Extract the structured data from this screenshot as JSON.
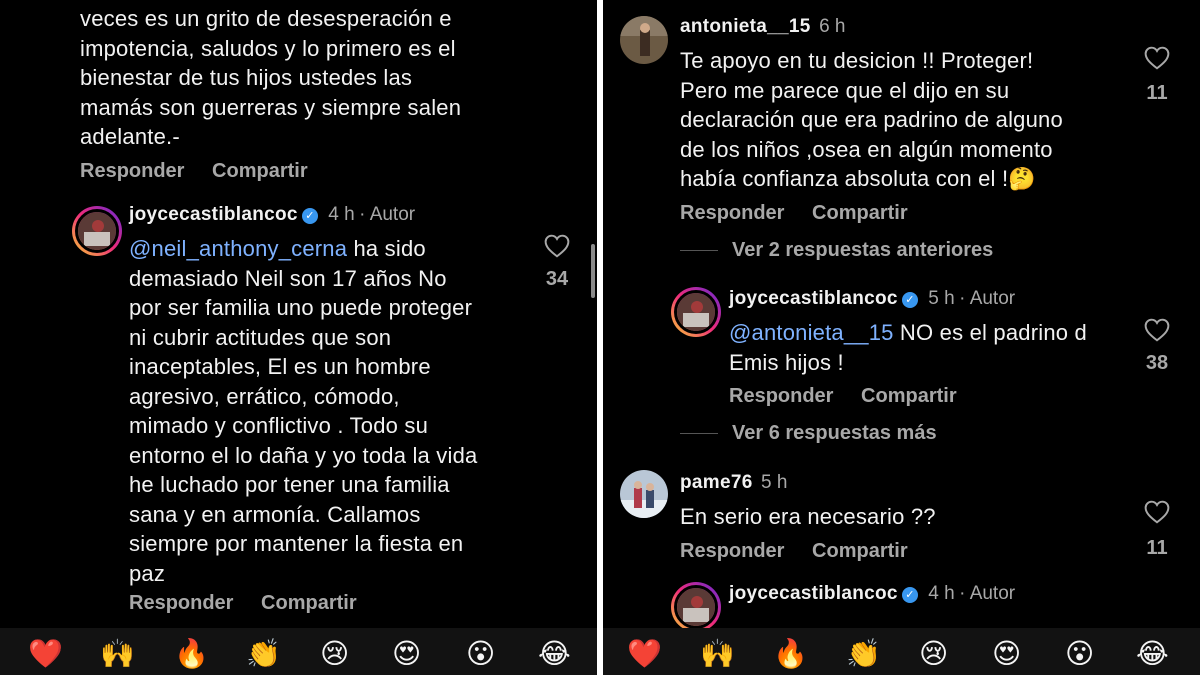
{
  "left": {
    "partial_comment": {
      "lines": [
        "veces es un grito de desesperación e",
        "impotencia, saludos y lo primero es el",
        "bienestar de tus hijos ustedes las",
        "mamás son guerreras y siempre salen",
        "adelante.-"
      ],
      "reply": "Responder",
      "share": "Compartir"
    },
    "reply_comment": {
      "username": "joycecastiblancoc",
      "time": "4 h",
      "author_label": "Autor",
      "mention": "@neil_anthony_cerna",
      "lines": [
        " ha sido",
        "demasiado Neil son 17 años No",
        "por ser familia uno puede proteger",
        "ni cubrir actitudes que son",
        "inaceptables, El es un hombre",
        "agresivo, errático, cómodo,",
        "mimado y conflictivo . Todo su",
        "entorno el lo daña y yo toda la vida",
        "he luchado por tener una familia",
        "sana y en armonía.  Callamos",
        "siempre por mantener la fiesta en",
        "paz"
      ],
      "likes": "34",
      "reply": "Responder",
      "share": "Compartir"
    },
    "emojis": [
      "❤️",
      "🙌",
      "🔥",
      "👏",
      "😢",
      "😍",
      "😮",
      "😂"
    ]
  },
  "right": {
    "comment1": {
      "username": "antonieta__15",
      "time": "6 h",
      "lines": [
        "Te apoyo en tu desicion !! Proteger!",
        "Pero me parece que el dijo en su",
        "declaración que era padrino de alguno",
        "de los niños ,osea en algún momento",
        "había confianza absoluta con el !🤔"
      ],
      "likes": "11",
      "reply": "Responder",
      "share": "Compartir",
      "view_prev": "Ver 2 respuestas anteriores"
    },
    "reply1": {
      "username": "joycecastiblancoc",
      "time": "5 h",
      "author_label": "Autor",
      "mention": "@antonieta__15",
      "line1_rest": " NO es el padrino d",
      "line2": "Emis hijos !",
      "likes": "38",
      "reply": "Responder",
      "share": "Compartir",
      "view_more": "Ver 6 respuestas más"
    },
    "comment2": {
      "username": "pame76",
      "time": "5 h",
      "text": "En serio era necesario ??",
      "likes": "11",
      "reply": "Responder",
      "share": "Compartir"
    },
    "reply2": {
      "username": "joycecastiblancoc",
      "time": "4 h",
      "author_label": "Autor"
    },
    "emojis": [
      "❤️",
      "🙌",
      "🔥",
      "👏",
      "😢",
      "😍",
      "😮",
      "😂"
    ]
  },
  "colors": {
    "background": "#000000",
    "mention": "#7fb2ff",
    "verified": "#3897f0",
    "muted": "#a8a8a8"
  }
}
